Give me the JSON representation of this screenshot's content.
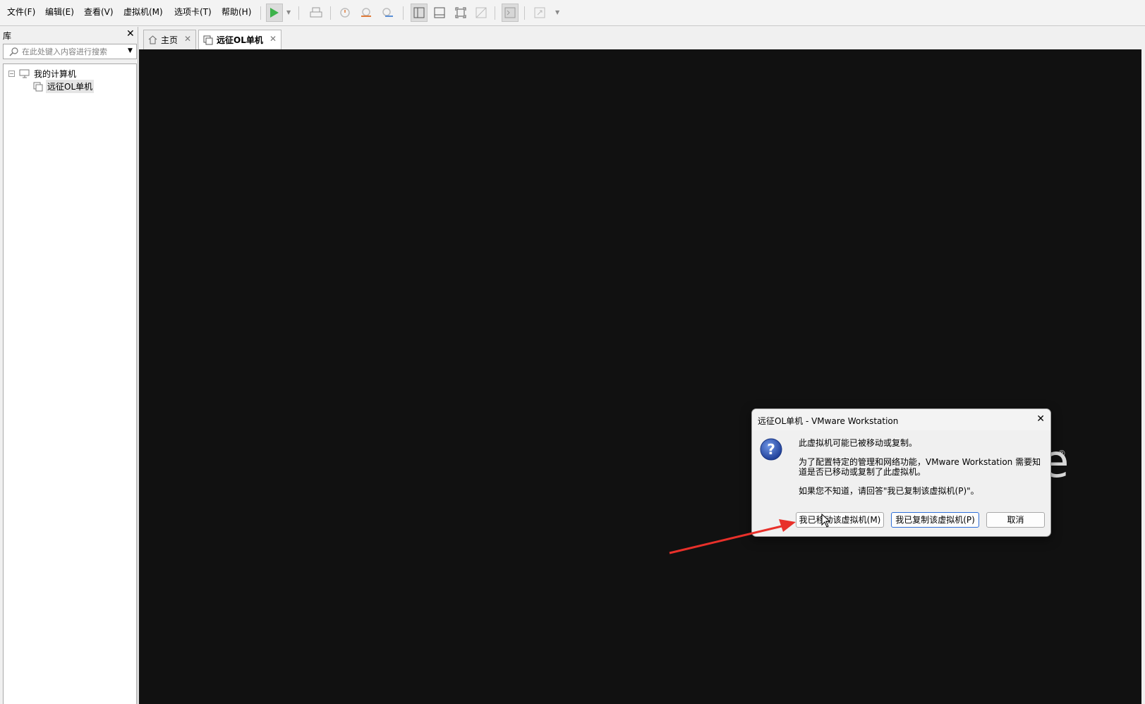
{
  "menubar": {
    "items": [
      "文件(F)",
      "编辑(E)",
      "查看(V)",
      "虚拟机(M)",
      "选项卡(T)",
      "帮助(H)"
    ]
  },
  "toolbar": {
    "buttons": [
      "power-on",
      "print-send",
      "snapshot-take",
      "snapshot-revert",
      "snapshot-manager",
      "show-library",
      "show-thumbnail",
      "fullscreen",
      "unity",
      "console-view",
      "stretch-guest"
    ],
    "accent_play": "#3cb24a",
    "accent_snapshot": "#e07b39"
  },
  "library": {
    "title": "库",
    "search_placeholder": "在此处键入内容进行搜索",
    "tree": {
      "root": "我的计算机",
      "child": "远征OL单机"
    }
  },
  "tabs": [
    {
      "label": "主页",
      "active": false
    },
    {
      "label": "远征OL单机",
      "active": true
    }
  ],
  "console": {
    "background": "#111111",
    "logo_visible_letter": "e",
    "logo_reg_mark": "®"
  },
  "dialog": {
    "title": "远征OL单机 - VMware Workstation",
    "line1": "此虚拟机可能已被移动或复制。",
    "line2a": "为了配置特定的管理和网络功能，VMware Workstation 需要知",
    "line2b": "道是否已移动或复制了此虚拟机。",
    "line3": "如果您不知道，请回答\"我已复制该虚拟机(P)\"。",
    "btn_moved": "我已移动该虚拟机(M)",
    "btn_copied": "我已复制该虚拟机(P)",
    "btn_cancel": "取消"
  },
  "annotation": {
    "arrow_color": "#e8302a"
  }
}
